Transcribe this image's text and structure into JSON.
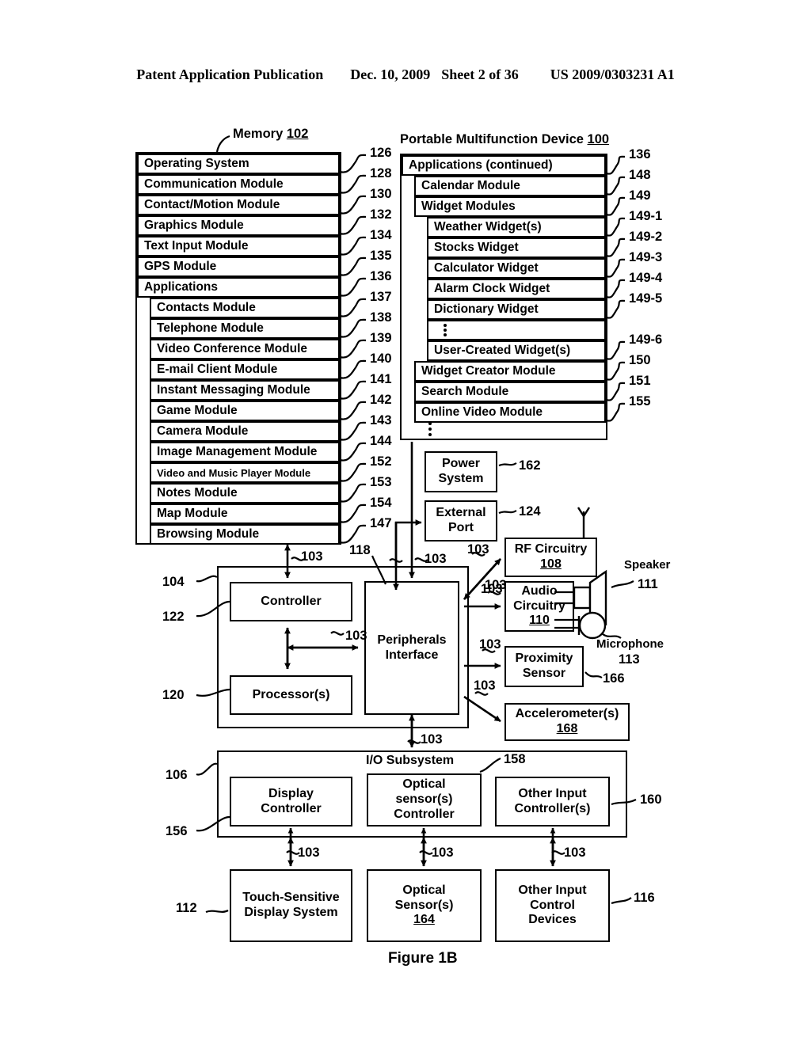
{
  "header": {
    "publication": "Patent Application Publication",
    "date": "Dec. 10, 2009",
    "sheet": "Sheet 2 of 36",
    "number": "US 2009/0303231 A1"
  },
  "figure_caption": "Figure 1B",
  "memory": {
    "caption_text": "Memory ",
    "caption_ref": "102",
    "rows": [
      {
        "label": "Operating System",
        "ref": "126",
        "indent": 0
      },
      {
        "label": "Communication Module",
        "ref": "128",
        "indent": 0
      },
      {
        "label": "Contact/Motion Module",
        "ref": "130",
        "indent": 0
      },
      {
        "label": "Graphics Module",
        "ref": "132",
        "indent": 0
      },
      {
        "label": "Text Input Module",
        "ref": "134",
        "indent": 0
      },
      {
        "label": "GPS Module",
        "ref": "135",
        "indent": 0
      },
      {
        "label": "Applications",
        "ref": "136",
        "indent": 0
      },
      {
        "label": "Contacts Module",
        "ref": "137",
        "indent": 1
      },
      {
        "label": "Telephone Module",
        "ref": "138",
        "indent": 1
      },
      {
        "label": "Video Conference Module",
        "ref": "139",
        "indent": 1
      },
      {
        "label": "E-mail Client Module",
        "ref": "140",
        "indent": 1
      },
      {
        "label": "Instant Messaging Module",
        "ref": "141",
        "indent": 1
      },
      {
        "label": "Game Module",
        "ref": "142",
        "indent": 1
      },
      {
        "label": "Camera Module",
        "ref": "143",
        "indent": 1
      },
      {
        "label": "Image Management Module",
        "ref": "144",
        "indent": 1
      },
      {
        "label": "Video and Music Player Module",
        "ref": "152",
        "indent": 1,
        "small": true
      },
      {
        "label": "Notes Module",
        "ref": "153",
        "indent": 1
      },
      {
        "label": "Map Module",
        "ref": "154",
        "indent": 1
      },
      {
        "label": "Browsing Module",
        "ref": "147",
        "indent": 1
      }
    ]
  },
  "device": {
    "caption_text": "Portable Multifunction Device ",
    "caption_ref": "100",
    "rows": [
      {
        "label": "Applications (continued)",
        "ref": "136",
        "indent": 0
      },
      {
        "label": "Calendar Module",
        "ref": "148",
        "indent": 1
      },
      {
        "label": "Widget Modules",
        "ref": "149",
        "indent": 1
      },
      {
        "label": "Weather Widget(s)",
        "ref": "149-1",
        "indent": 2
      },
      {
        "label": "Stocks Widget",
        "ref": "149-2",
        "indent": 2
      },
      {
        "label": "Calculator Widget",
        "ref": "149-3",
        "indent": 2
      },
      {
        "label": "Alarm Clock Widget",
        "ref": "149-4",
        "indent": 2
      },
      {
        "label": "Dictionary Widget",
        "ref": "149-5",
        "indent": 2
      },
      {
        "label": "",
        "ref": "",
        "indent": 2,
        "dots": true
      },
      {
        "label": "User-Created Widget(s)",
        "ref": "149-6",
        "indent": 2
      },
      {
        "label": "Widget Creator Module",
        "ref": "150",
        "indent": 1
      },
      {
        "label": "Search Module",
        "ref": "151",
        "indent": 1
      },
      {
        "label": "Online Video Module",
        "ref": "155",
        "indent": 1
      }
    ]
  },
  "blocks": {
    "power_system": {
      "lines": [
        "Power",
        "System"
      ],
      "ref": "162"
    },
    "external_port": {
      "lines": [
        "External",
        "Port"
      ],
      "ref": "124"
    },
    "rf_circuitry": {
      "lines": [
        "RF Circuitry"
      ],
      "underlined": "108",
      "ref": ""
    },
    "audio_circuitry": {
      "lines": [
        "Audio",
        "Circuitry",
        "110"
      ],
      "ref": ""
    },
    "proximity": {
      "lines": [
        "Proximity",
        "Sensor"
      ],
      "ref": "166"
    },
    "accelerometer": {
      "lines": [
        "Accelerometer(s)"
      ],
      "underlined": "168",
      "ref": ""
    },
    "controller": {
      "lines": [
        "Controller"
      ],
      "ref": "122"
    },
    "processors": {
      "lines": [
        "Processor(s)"
      ],
      "ref": "120"
    },
    "peripherals": {
      "lines": [
        "Peripherals",
        "Interface"
      ],
      "ref": "118"
    },
    "cpu_outer_ref": "104",
    "io_subsystem": {
      "title": "I/O Subsystem",
      "ref": "106",
      "ref2": "156",
      "title_ref": "158"
    },
    "display_controller": {
      "lines": [
        "Display",
        "Controller"
      ],
      "ref": ""
    },
    "optical_sensor_controller": {
      "lines": [
        "Optical",
        "sensor(s)",
        "Controller"
      ],
      "ref": ""
    },
    "other_input_controllers": {
      "lines": [
        "Other Input",
        "Controller(s)"
      ],
      "ref": "160"
    },
    "touch_display": {
      "lines": [
        "Touch-Sensitive",
        "Display System"
      ],
      "ref": "112"
    },
    "optical_sensors": {
      "lines": [
        "Optical",
        "Sensor(s)"
      ],
      "underlined": "164",
      "ref": ""
    },
    "other_input_devices": {
      "lines": [
        "Other Input",
        "Control",
        "Devices"
      ],
      "ref": "116"
    },
    "speaker": {
      "label": "Speaker",
      "ref": "111"
    },
    "microphone": {
      "label": "Microphone",
      "ref": "113"
    }
  },
  "bus_labels": {
    "b1": "103",
    "b2": "103",
    "b3": "103",
    "b4": "103",
    "b5": "103",
    "b6": "103",
    "b7": "103",
    "b8": "103",
    "b9": "103",
    "b10": "103",
    "b11": "103",
    "b12": "103",
    "b13": "103"
  },
  "colors": {
    "line": "#000000",
    "background": "#ffffff"
  }
}
